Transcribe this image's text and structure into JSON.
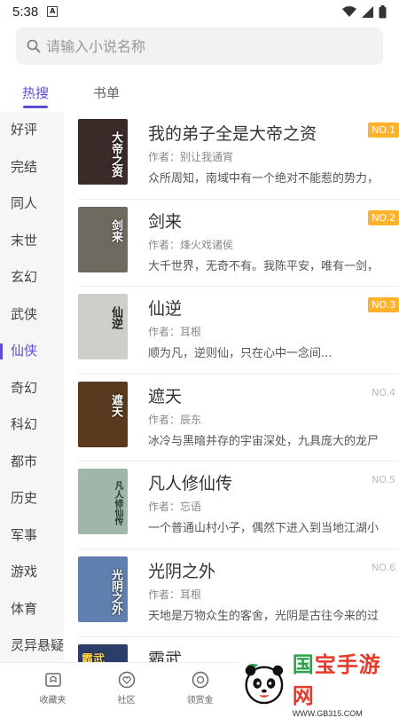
{
  "status": {
    "time": "5:38",
    "notif": "A"
  },
  "search": {
    "placeholder": "请输入小说名称"
  },
  "tabs": [
    {
      "label": "热搜"
    },
    {
      "label": "书单"
    }
  ],
  "sidebar": {
    "items": [
      {
        "label": "好评"
      },
      {
        "label": "完结"
      },
      {
        "label": "同人"
      },
      {
        "label": "末世"
      },
      {
        "label": "玄幻"
      },
      {
        "label": "武侠"
      },
      {
        "label": "仙侠"
      },
      {
        "label": "奇幻"
      },
      {
        "label": "科幻"
      },
      {
        "label": "都市"
      },
      {
        "label": "历史"
      },
      {
        "label": "军事"
      },
      {
        "label": "游戏"
      },
      {
        "label": "体育"
      },
      {
        "label": "灵异悬疑"
      }
    ]
  },
  "books": [
    {
      "title": "我的弟子全是大帝之资",
      "author": "作者：别让我通宵",
      "desc": "众所周知，南域中有一个绝对不能惹的势力，",
      "rank": "NO.1",
      "cover_text": "大帝之资",
      "cover_color": "#3a2a28"
    },
    {
      "title": "剑来",
      "author": "作者：烽火戏诸侯",
      "desc": "大千世界，无奇不有。我陈平安，唯有一剑，",
      "rank": "NO.2",
      "cover_text": "剑来",
      "cover_color": "#6f6a60"
    },
    {
      "title": "仙逆",
      "author": "作者：耳根",
      "desc": "顺为凡，逆则仙，只在心中一念间...",
      "rank": "NO.3",
      "cover_text": "仙逆",
      "cover_color": "#cfcfca"
    },
    {
      "title": "遮天",
      "author": "作者：辰东",
      "desc": "冰冷与黑暗并存的宇宙深处，九具庞大的龙尸",
      "rank": "NO.4",
      "cover_text": "遮天",
      "cover_color": "#5a3a1e"
    },
    {
      "title": "凡人修仙传",
      "author": "作者：忘语",
      "desc": "一个普通山村小子，偶然下进入到当地江湖小",
      "rank": "NO.5",
      "cover_text": "凡人修仙传",
      "cover_color": "#9fb6a8"
    },
    {
      "title": "光阴之外",
      "author": "作者：耳根",
      "desc": "天地是万物众生的客舍，光阴是古往今来的过",
      "rank": "NO.6",
      "cover_text": "光阴之外",
      "cover_color": "#5f7fae"
    },
    {
      "title": "霸武",
      "author": "",
      "desc": "",
      "rank": "",
      "cover_text": "霸武",
      "cover_color": "#2b3d6a"
    }
  ],
  "bottom_nav": [
    {
      "label": "收藏夹",
      "icon": "bookmark-folder-icon"
    },
    {
      "label": "社区",
      "icon": "heart-bubble-icon"
    },
    {
      "label": "领赏金",
      "icon": "coin-icon"
    }
  ],
  "watermark": {
    "main_colored": "国",
    "main": "宝手游网",
    "sub": "WWW.GB315.COM"
  },
  "colors": {
    "accent": "#5b4ed6",
    "rank_badge": "#ffb22a"
  }
}
